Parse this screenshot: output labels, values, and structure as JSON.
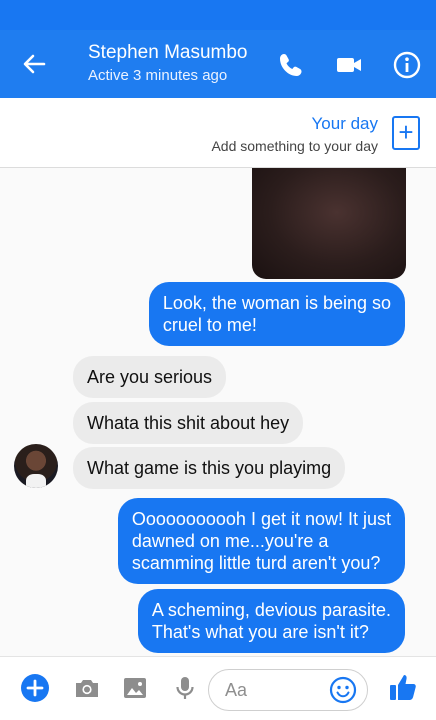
{
  "header": {
    "contact_name": "Stephen Masumbo",
    "status": "Active 3 minutes ago",
    "icons": [
      "back-arrow-icon",
      "phone-icon",
      "video-camera-icon",
      "info-icon"
    ],
    "accent_color": "#1877f2"
  },
  "your_day": {
    "title": "Your day",
    "subtitle": "Add something to your day",
    "plus_icon": "+"
  },
  "messages": [
    {
      "from": "me",
      "text_lines": [
        "Look, the woman is being so",
        "cruel to me!"
      ]
    },
    {
      "from": "contact",
      "text_lines": [
        "Are you serious"
      ]
    },
    {
      "from": "contact",
      "text_lines": [
        "Whata this shit about hey"
      ]
    },
    {
      "from": "contact",
      "text_lines": [
        "What game is this you playimg"
      ]
    },
    {
      "from": "me",
      "text_lines": [
        "Ooooooooooh I get it now! It just",
        "dawned on me...you're a",
        "scamming little turd aren't you?"
      ]
    },
    {
      "from": "me",
      "text_lines": [
        "A scheming, devious parasite.",
        "That's what you are isn't it?"
      ]
    }
  ],
  "composer": {
    "placeholder": "Aa",
    "icons": [
      "plus-icon",
      "camera-icon",
      "gallery-icon",
      "microphone-icon",
      "emoji-icon",
      "like-icon"
    ]
  }
}
